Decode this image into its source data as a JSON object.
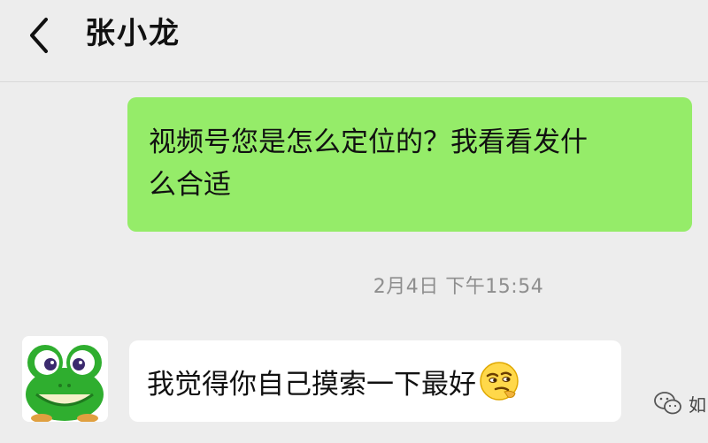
{
  "header": {
    "contact_name": "张小龙",
    "back_icon": "chevron-left-icon"
  },
  "messages": [
    {
      "direction": "out",
      "lines": [
        "视频号您是怎么定位的？我看看发什",
        "么合适"
      ],
      "bubble_color": "#95ec69"
    },
    {
      "direction": "in",
      "text": "我觉得你自己摸索一下最好",
      "emoji": "smirk-emoji-icon",
      "avatar": "frog-avatar"
    }
  ],
  "timestamp": "2月4日 下午15:54",
  "watermark": {
    "icon": "wechat-logo-icon",
    "text": "如"
  },
  "colors": {
    "background": "#ededed",
    "outgoing_bubble": "#95ec69",
    "incoming_bubble": "#ffffff",
    "timestamp": "#8e8e8e"
  }
}
